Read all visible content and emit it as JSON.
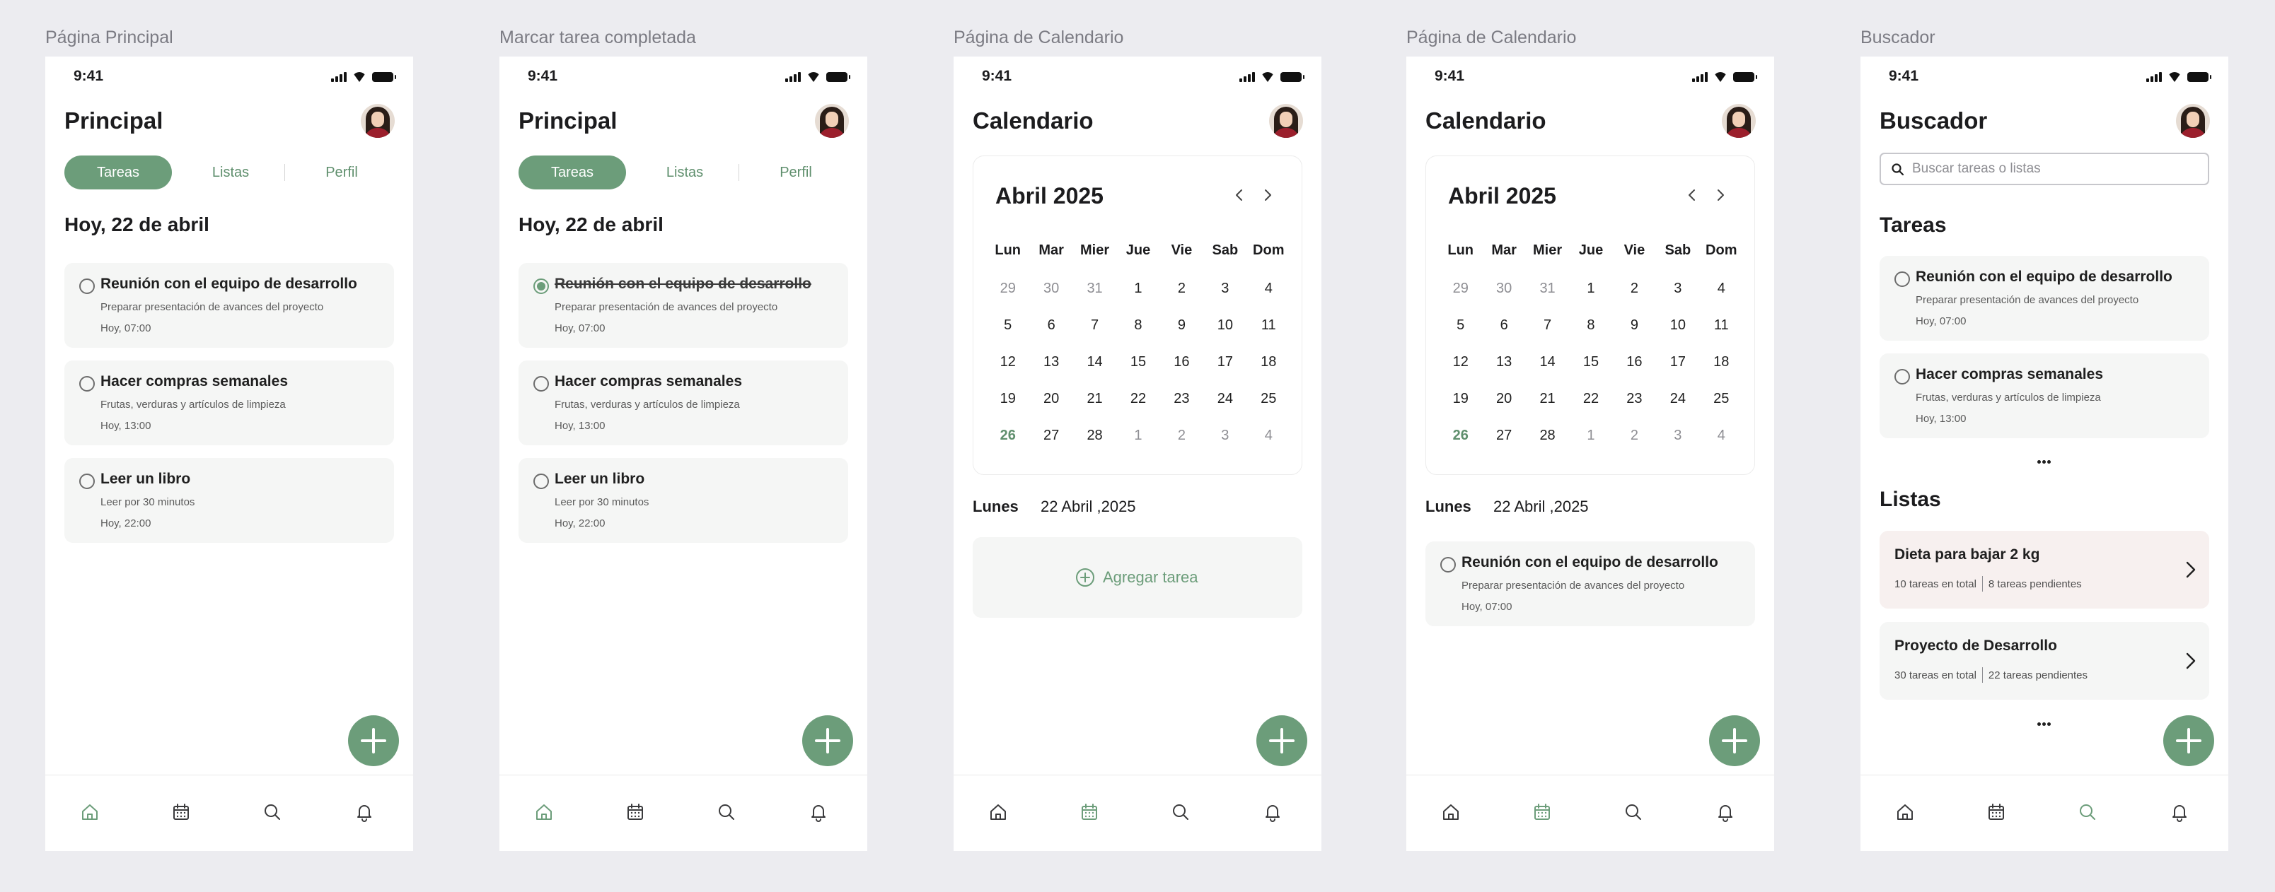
{
  "status": {
    "time": "9:41"
  },
  "frames": [
    {
      "caption": "Página Principal",
      "title": "Principal",
      "tabs": [
        "Tareas",
        "Listas",
        "Perfil"
      ],
      "heading": "Hoy, 22 de abril",
      "tasks": [
        {
          "title": "Reunión con el equipo de desarrollo",
          "subtitle": "Preparar presentación de avances del proyecto",
          "time": "Hoy, 07:00",
          "completed": false
        },
        {
          "title": "Hacer compras semanales",
          "subtitle": "Frutas, verduras y artículos de limpieza",
          "time": "Hoy, 13:00",
          "completed": false
        },
        {
          "title": "Leer un libro",
          "subtitle": "Leer por 30 minutos",
          "time": "Hoy, 22:00",
          "completed": false
        }
      ],
      "active_nav": "home"
    },
    {
      "caption": "Marcar tarea completada",
      "title": "Principal",
      "tabs": [
        "Tareas",
        "Listas",
        "Perfil"
      ],
      "heading": "Hoy, 22 de abril",
      "tasks": [
        {
          "title": "Reunión con el equipo de desarrollo",
          "subtitle": "Preparar presentación de avances del proyecto",
          "time": "Hoy, 07:00",
          "completed": true
        },
        {
          "title": "Hacer compras semanales",
          "subtitle": "Frutas, verduras y artículos de limpieza",
          "time": "Hoy, 13:00",
          "completed": false
        },
        {
          "title": "Leer un libro",
          "subtitle": "Leer por 30 minutos",
          "time": "Hoy, 22:00",
          "completed": false
        }
      ],
      "active_nav": "home"
    },
    {
      "caption": "Página de Calendario",
      "title": "Calendario",
      "calendar": {
        "month": "Abril 2025",
        "weekdays": [
          "Lun",
          "Mar",
          "Mier",
          "Jue",
          "Vie",
          "Sab",
          "Dom"
        ],
        "days": [
          "29",
          "30",
          "31",
          "1",
          "2",
          "3",
          "4",
          "5",
          "6",
          "7",
          "8",
          "9",
          "10",
          "11",
          "12",
          "13",
          "14",
          "15",
          "16",
          "17",
          "18",
          "19",
          "20",
          "21",
          "22",
          "23",
          "24",
          "25",
          "26",
          "27",
          "28",
          "1",
          "2",
          "3",
          "4"
        ],
        "muted_days": [
          0,
          1,
          2,
          31,
          32,
          33,
          34
        ],
        "today_index": 28
      },
      "selected_day": {
        "weekday": "Lunes",
        "date": "22 Abril ,2025"
      },
      "add_task_label": "Agregar tarea",
      "active_nav": "calendar"
    },
    {
      "caption": "Página de Calendario",
      "title": "Calendario",
      "calendar": {
        "month": "Abril 2025",
        "weekdays": [
          "Lun",
          "Mar",
          "Mier",
          "Jue",
          "Vie",
          "Sab",
          "Dom"
        ],
        "days": [
          "29",
          "30",
          "31",
          "1",
          "2",
          "3",
          "4",
          "5",
          "6",
          "7",
          "8",
          "9",
          "10",
          "11",
          "12",
          "13",
          "14",
          "15",
          "16",
          "17",
          "18",
          "19",
          "20",
          "21",
          "22",
          "23",
          "24",
          "25",
          "26",
          "27",
          "28",
          "1",
          "2",
          "3",
          "4"
        ],
        "muted_days": [
          0,
          1,
          2,
          31,
          32,
          33,
          34
        ],
        "today_index": 28
      },
      "selected_day": {
        "weekday": "Lunes",
        "date": "22 Abril ,2025"
      },
      "day_task": {
        "title": "Reunión con el equipo de desarrollo",
        "subtitle": "Preparar presentación de avances del proyecto",
        "time": "Hoy, 07:00"
      },
      "active_nav": "calendar"
    },
    {
      "caption": "Buscador",
      "title": "Buscador",
      "search_placeholder": "Buscar tareas o listas",
      "tasks_heading": "Tareas",
      "tasks": [
        {
          "title": "Reunión con el equipo de desarrollo",
          "subtitle": "Preparar presentación de avances del proyecto",
          "time": "Hoy, 07:00"
        },
        {
          "title": "Hacer compras semanales",
          "subtitle": "Frutas, verduras y artículos de limpieza",
          "time": "Hoy, 13:00"
        }
      ],
      "lists_heading": "Listas",
      "lists": [
        {
          "title": "Dieta para bajar 2 kg",
          "total": "10 tareas en total",
          "pending": "8 tareas pendientes",
          "color": "#f7f0ef"
        },
        {
          "title": "Proyecto de Desarrollo",
          "total": "30 tareas en total",
          "pending": "22 tareas pendientes",
          "color": "#f5f6f5"
        }
      ],
      "active_nav": "search"
    }
  ],
  "colors": {
    "accent": "#6c9d7a",
    "nav_inactive": "#3a3a3c",
    "background": "#ececf0"
  },
  "nav_icons": [
    "home-icon",
    "calendar-icon",
    "search-icon",
    "bell-icon"
  ]
}
